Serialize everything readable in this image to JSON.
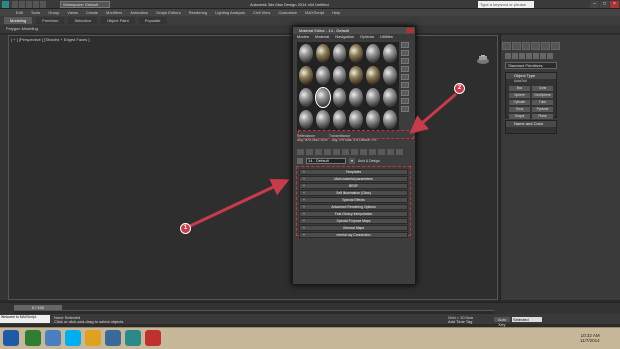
{
  "app": {
    "title": "Autodesk 3ds Max Design 2014 x64    Untitled",
    "workspace": "Workspace: Default",
    "search_placeholder": "Type a keyword or phrase"
  },
  "menu": [
    "Edit",
    "Tools",
    "Group",
    "Views",
    "Create",
    "Modifiers",
    "Animation",
    "Graph Editors",
    "Rendering",
    "Lighting Analysis",
    "Civil View",
    "Customize",
    "MAXScript",
    "Help"
  ],
  "ribbon": {
    "tabs": [
      "Modeling",
      "Freeform",
      "Selection",
      "Object Paint",
      "Populate"
    ],
    "sub_label": "Polygon Modeling"
  },
  "viewport": {
    "label": "[ + ] [Perspective ] [Shaded + Edged Faces ]"
  },
  "material_editor": {
    "title": "Material Editor - 14 - Default",
    "menu": [
      "Modes",
      "Material",
      "Navigation",
      "Options",
      "Utilities"
    ],
    "reflectance_label": "Reflectance",
    "reflectance_vals": "Avg: 50% Max: 50%",
    "transmittance_label": "Transmittance",
    "transmittance_vals": "Avg: 0% Max: 0% Diffuse: 0%",
    "material_name": "14 - Default",
    "material_type": "Arch & Design",
    "rollups": [
      "Templates",
      "Main material parameters",
      "BRDF",
      "Self Illumination (Glow)",
      "Special Effects",
      "Advanced Rendering Options",
      "Fast Glossy Interpolation",
      "Special Purpose Maps",
      "General Maps",
      "mental ray Connection"
    ]
  },
  "command_panel": {
    "category_select": "Standard Primitives",
    "object_type_header": "Object Type",
    "autogrid": "AutoGrid",
    "objects": [
      "Box",
      "Cone",
      "Sphere",
      "GeoSphere",
      "Cylinder",
      "Tube",
      "Torus",
      "Pyramid",
      "Teapot",
      "Plane"
    ],
    "name_color_header": "Name and Color"
  },
  "timeline": {
    "slider": "0 / 100"
  },
  "status": {
    "maxscript_mini": "Welcome to MAXScript.",
    "line1": "None Selected",
    "line2": "Click or click-and-drag to select objects",
    "grid": "Grid = 10.0cm",
    "add_time_tag": "Add Time Tag",
    "auto_key": "Auto Key",
    "set_key_select": "Selected"
  },
  "annotations": {
    "badge1": "1",
    "badge2": "2"
  },
  "clock": {
    "time": "10:32 AM",
    "date": "11/7/2014"
  },
  "colors": {
    "accent_red": "#c83b4a"
  }
}
